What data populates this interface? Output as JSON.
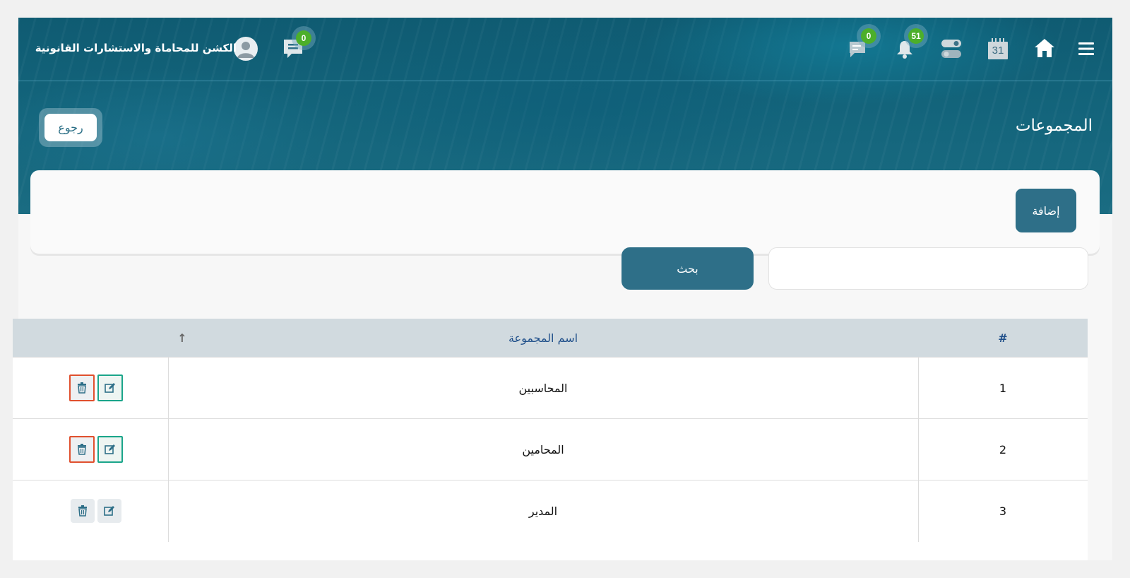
{
  "header": {
    "company_name": "الكشن للمحاماة والاستشارات القانونية",
    "chat_badge": "0",
    "messages_badge": "0",
    "notifications_badge": "51",
    "calendar_day": "31"
  },
  "page": {
    "title": "المجموعات",
    "back_label": "رجوع",
    "add_label": "إضافة"
  },
  "search": {
    "value": "",
    "placeholder": "",
    "button_label": "بحث"
  },
  "table": {
    "columns": {
      "index": "#",
      "name": "اسم المجموعة",
      "sort_icon": "↑"
    },
    "rows": [
      {
        "index": "1",
        "name": "المحاسبين"
      },
      {
        "index": "2",
        "name": "المحامين"
      },
      {
        "index": "3",
        "name": "المدير"
      }
    ]
  },
  "colors": {
    "primary": "#2e6f88",
    "badge": "#4caf2a",
    "edit_border": "#1aa58a",
    "delete_border": "#e0502e",
    "header_text": "#1f4f8a"
  }
}
